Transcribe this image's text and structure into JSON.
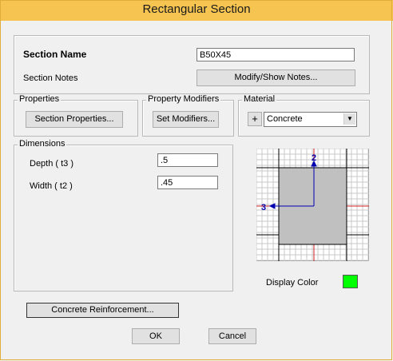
{
  "window": {
    "title": "Rectangular Section"
  },
  "section": {
    "name_label": "Section Name",
    "name_value": "B50X45",
    "notes_label": "Section Notes",
    "notes_button": "Modify/Show Notes..."
  },
  "properties": {
    "group_label": "Properties",
    "button": "Section Properties..."
  },
  "modifiers": {
    "group_label": "Property Modifiers",
    "button": "Set Modifiers..."
  },
  "material": {
    "group_label": "Material",
    "add_button": "+",
    "selected": "Concrete"
  },
  "dimensions": {
    "group_label": "Dimensions",
    "depth_label": "Depth  ( t3 )",
    "depth_value": ".5",
    "width_label": "Width  ( t2 )",
    "width_value": ".45"
  },
  "preview": {
    "axis2_label": "2",
    "axis3_label": "3",
    "section_fill": "#c0c0c0",
    "axis_color": "#0000b0"
  },
  "display_color": {
    "label": "Display Color",
    "color": "#00ff00"
  },
  "buttons": {
    "reinforcement": "Concrete Reinforcement...",
    "ok": "OK",
    "cancel": "Cancel"
  },
  "colors": {
    "titlebar": "#f5c451",
    "background": "#f0f0f0"
  }
}
